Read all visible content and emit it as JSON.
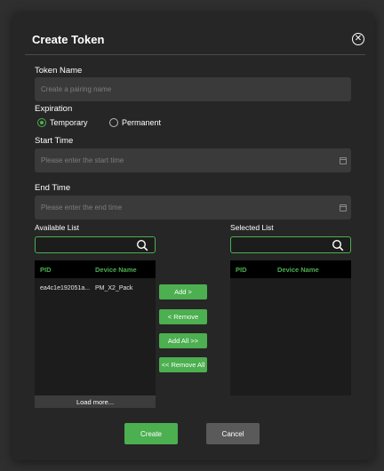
{
  "dialog": {
    "title": "Create Token",
    "close_icon": "close-circle-icon"
  },
  "token_name": {
    "label": "Token Name",
    "placeholder": "Create a pairing name",
    "value": ""
  },
  "expiration": {
    "label": "Expiration",
    "options": [
      {
        "label": "Temporary",
        "selected": true
      },
      {
        "label": "Permanent",
        "selected": false
      }
    ]
  },
  "start_time": {
    "label": "Start Time",
    "placeholder": "Please enter the start time",
    "icon": "calendar-icon"
  },
  "end_time": {
    "label": "End Time",
    "placeholder": "Please enter the end time",
    "icon": "calendar-icon"
  },
  "available_list": {
    "label": "Available List",
    "search_icon": "search-icon",
    "columns": [
      "PID",
      "Device Name"
    ],
    "rows": [
      {
        "pid": "ea4c1e192051a...",
        "device_name": "PM_X2_Pack"
      }
    ],
    "load_more": "Load more..."
  },
  "selected_list": {
    "label": "Selected List",
    "search_icon": "search-icon",
    "columns": [
      "PID",
      "Device Name"
    ],
    "rows": []
  },
  "transfer_buttons": {
    "add": "Add >",
    "remove": "< Remove",
    "add_all": "Add All >>",
    "remove_all": "<< Remove All"
  },
  "footer": {
    "create": "Create",
    "cancel": "Cancel"
  },
  "colors": {
    "accent": "#4caf50",
    "dialog_bg": "#262626",
    "input_bg": "#3a3a3a",
    "cancel_bg": "#5a5a5a"
  }
}
